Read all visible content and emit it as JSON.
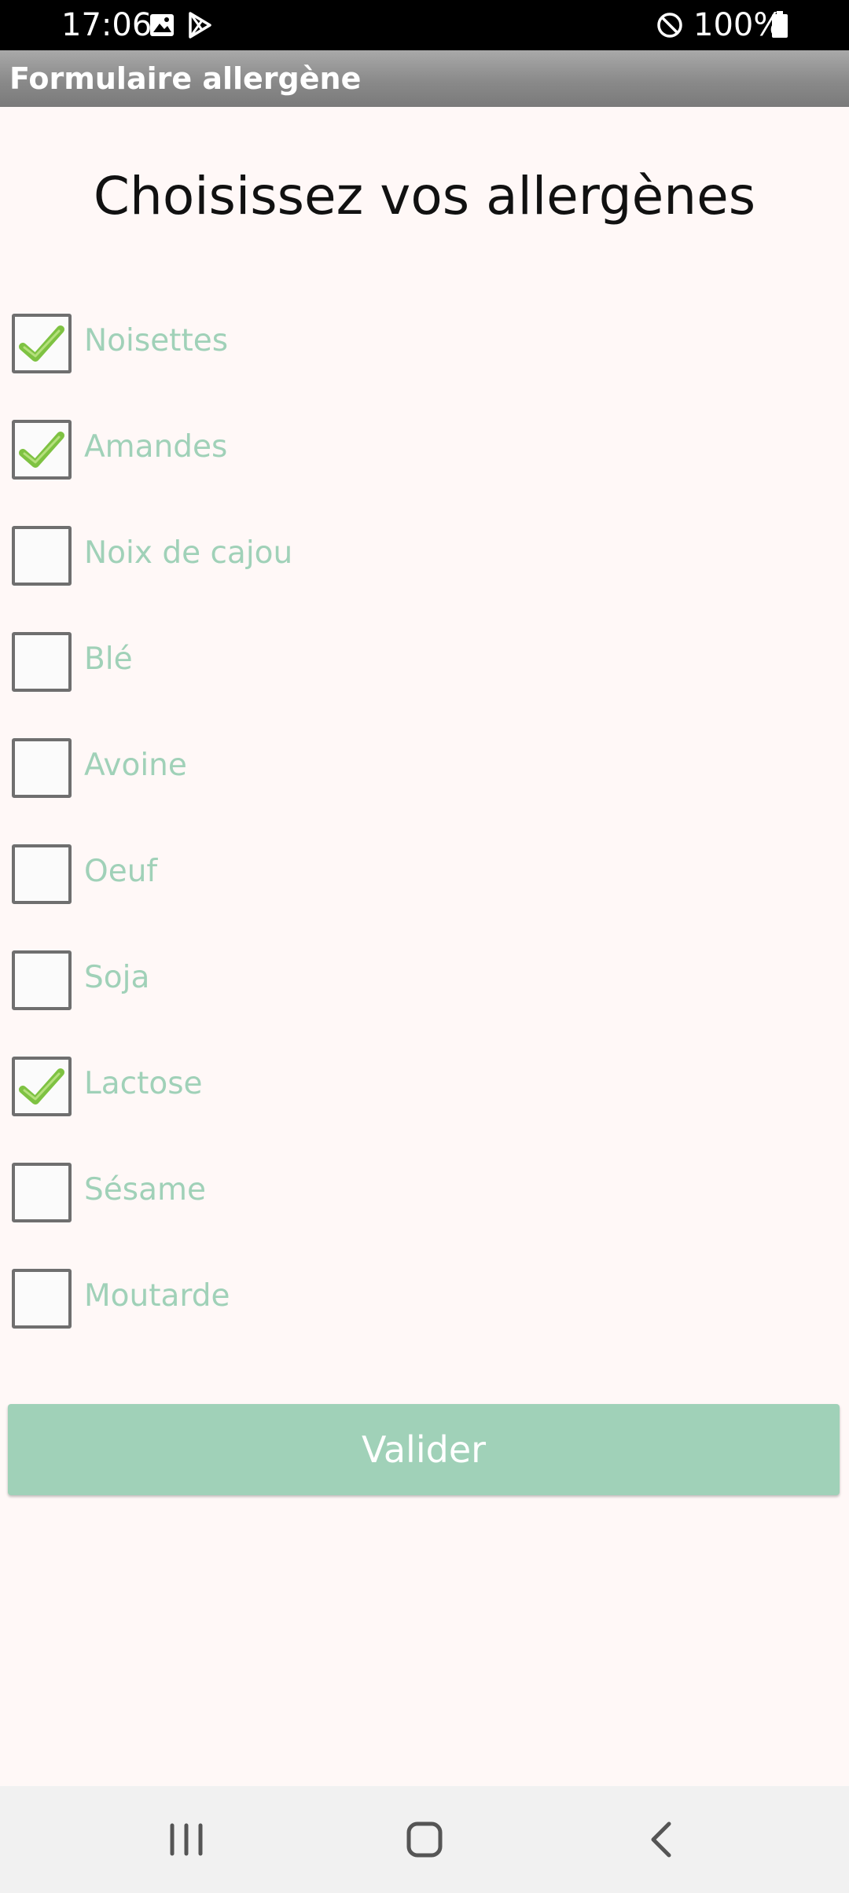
{
  "status_bar": {
    "time": "17:06",
    "battery": "100%",
    "icons": [
      "image-icon",
      "play-store-icon",
      "do-not-disturb-icon",
      "battery-icon"
    ]
  },
  "app_bar": {
    "title": "Formulaire allergène"
  },
  "main": {
    "heading": "Choisissez vos allergènes",
    "allergens": [
      {
        "label": "Noisettes",
        "checked": true
      },
      {
        "label": "Amandes",
        "checked": true
      },
      {
        "label": "Noix de cajou",
        "checked": false
      },
      {
        "label": "Blé",
        "checked": false
      },
      {
        "label": "Avoine",
        "checked": false
      },
      {
        "label": "Oeuf",
        "checked": false
      },
      {
        "label": "Soja",
        "checked": false
      },
      {
        "label": "Lactose",
        "checked": true
      },
      {
        "label": "Sésame",
        "checked": false
      },
      {
        "label": "Moutarde",
        "checked": false
      }
    ],
    "validate_label": "Valider"
  },
  "nav_bar": {
    "icons": [
      "recent-apps-icon",
      "home-icon",
      "back-icon"
    ]
  },
  "colors": {
    "accent": "#a0d1b8",
    "check": "#7ec242",
    "background": "#fff8f7"
  }
}
